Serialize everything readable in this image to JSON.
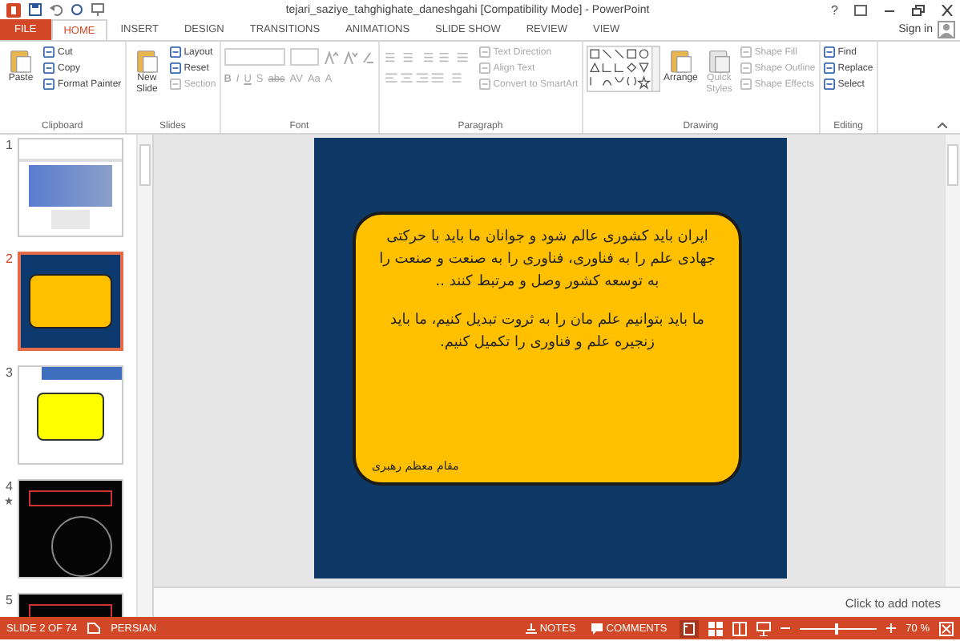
{
  "window": {
    "title": "tejari_saziye_tahghighate_daneshgahi [Compatibility Mode] - PowerPoint",
    "help": "?"
  },
  "tabs": [
    {
      "label": "FILE",
      "kind": "file",
      "selected": false
    },
    {
      "label": "HOME",
      "kind": "tab",
      "selected": true
    },
    {
      "label": "INSERT",
      "kind": "tab",
      "selected": false
    },
    {
      "label": "DESIGN",
      "kind": "tab",
      "selected": false
    },
    {
      "label": "TRANSITIONS",
      "kind": "tab",
      "selected": false
    },
    {
      "label": "ANIMATIONS",
      "kind": "tab",
      "selected": false
    },
    {
      "label": "SLIDE SHOW",
      "kind": "tab",
      "selected": false
    },
    {
      "label": "REVIEW",
      "kind": "tab",
      "selected": false
    },
    {
      "label": "VIEW",
      "kind": "tab",
      "selected": false
    }
  ],
  "account": {
    "label": "Sign in"
  },
  "ribbon": [
    {
      "label": "Clipboard",
      "kind": "clipboard",
      "large": [
        {
          "label": "Paste",
          "disabled": false
        }
      ],
      "small": [
        {
          "label": "Cut",
          "disabled": false
        },
        {
          "label": "Copy",
          "disabled": false
        },
        {
          "label": "Format Painter",
          "disabled": false
        }
      ]
    },
    {
      "label": "Slides",
      "kind": "slides",
      "large": [
        {
          "label": "New Slide",
          "disabled": false
        }
      ],
      "small": [
        {
          "label": "Layout",
          "disabled": false
        },
        {
          "label": "Reset",
          "disabled": false
        },
        {
          "label": "Section",
          "disabled": true
        }
      ]
    },
    {
      "label": "Font",
      "kind": "font",
      "disabled": true,
      "buttons": [
        "B",
        "I",
        "U",
        "S",
        "abc",
        "AV",
        "Aa",
        "A"
      ]
    },
    {
      "label": "Paragraph",
      "kind": "paragraph",
      "small": [
        {
          "label": "Text Direction",
          "disabled": true
        },
        {
          "label": "Align Text",
          "disabled": true
        },
        {
          "label": "Convert to SmartArt",
          "disabled": true
        }
      ]
    },
    {
      "label": "Drawing",
      "kind": "drawing",
      "large": [
        {
          "label": "Arrange",
          "disabled": false
        },
        {
          "label": "Quick Styles",
          "disabled": true
        }
      ],
      "small": [
        {
          "label": "Shape Fill",
          "disabled": true
        },
        {
          "label": "Shape Outline",
          "disabled": true
        },
        {
          "label": "Shape Effects",
          "disabled": true
        }
      ]
    },
    {
      "label": "Editing",
      "kind": "editing",
      "small": [
        {
          "label": "Find",
          "disabled": false
        },
        {
          "label": "Replace",
          "disabled": false
        },
        {
          "label": "Select",
          "disabled": false
        }
      ]
    }
  ],
  "thumbnails": [
    {
      "number": "1",
      "kind": "light-picture",
      "selected": false,
      "animated": false
    },
    {
      "number": "2",
      "kind": "blue-yellow",
      "selected": true,
      "animated": false
    },
    {
      "number": "3",
      "kind": "light-yellow",
      "selected": false,
      "animated": false
    },
    {
      "number": "4",
      "kind": "dark",
      "selected": false,
      "animated": true
    },
    {
      "number": "5",
      "kind": "dark",
      "selected": false,
      "animated": false
    }
  ],
  "slide": {
    "paragraphs": [
      "ایران باید کشوری عالم شود و جوانان ما باید با حرکتی جهادی علم را به فناوری، فناوری را به صنعت و صنعت را به توسعه کشور وصل و مرتبط کنند ..",
      "ما باید بتوانیم علم مان را به ثروت تبدیل کنیم، ما باید زنجیره علم و فناوری را تکمیل کنیم."
    ],
    "signature": "مقام معظم رهبری"
  },
  "notes": {
    "placeholder": "Click to add notes"
  },
  "status_bar": {
    "slide": "SLIDE 2 OF 74",
    "language": "PERSIAN",
    "notes": "NOTES",
    "comments": "COMMENTS",
    "zoom": {
      "level": 0.45,
      "reading": "70 %"
    }
  }
}
